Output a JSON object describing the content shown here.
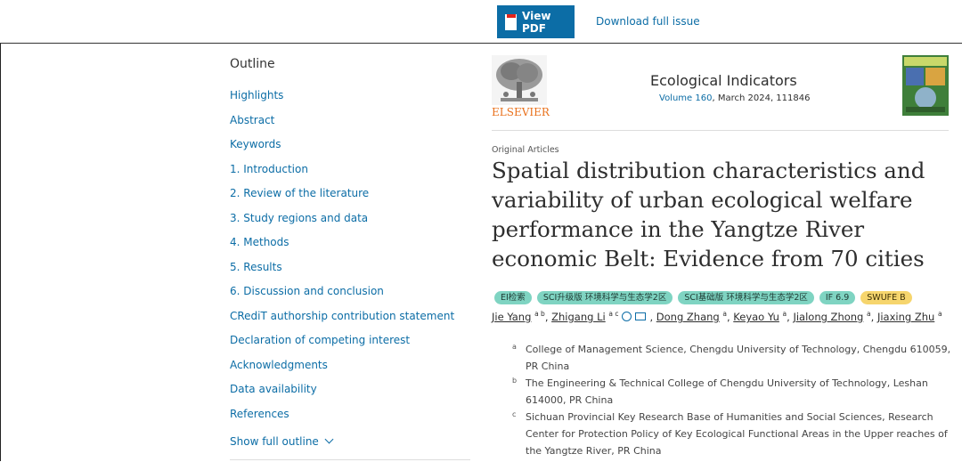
{
  "toolbar": {
    "view_pdf": "View PDF",
    "download_issue": "Download full issue"
  },
  "outline": {
    "title": "Outline",
    "items": [
      "Highlights",
      "Abstract",
      "Keywords",
      "1. Introduction",
      "2. Review of the literature",
      "3. Study regions and data",
      "4. Methods",
      "5. Results",
      "6. Discussion and conclusion",
      "CRediT authorship contribution statement",
      "Declaration of competing interest",
      "Acknowledgments",
      "Data availability",
      "References"
    ],
    "show_full": "Show full outline"
  },
  "header": {
    "publisher": "ELSEVIER",
    "journal": "Ecological Indicators",
    "volume_link": "Volume 160",
    "volume_rest": ", March 2024, 111846"
  },
  "article": {
    "type": "Original Articles",
    "title": "Spatial distribution characteristics and variability of urban ecological welfare performance in the Yangtze River economic Belt: Evidence from 70 cities",
    "badges": [
      "EI检索",
      "SCI升级版 环境科学与生态学2区",
      "SCI基础版 环境科学与生态学2区",
      "IF 6.9",
      "SWUFE B"
    ],
    "authors": [
      {
        "name": "Jie Yang",
        "sup": "a b"
      },
      {
        "name": "Zhigang Li",
        "sup": "a c"
      },
      {
        "name": "Dong Zhang",
        "sup": "a"
      },
      {
        "name": "Keyao Yu",
        "sup": "a"
      },
      {
        "name": "Jialong Zhong",
        "sup": "a"
      },
      {
        "name": "Jiaxing Zhu",
        "sup": "a"
      }
    ],
    "affiliations": [
      {
        "label": "a",
        "text": "College of Management Science, Chengdu University of Technology, Chengdu 610059, PR China"
      },
      {
        "label": "b",
        "text": "The Engineering & Technical College of Chengdu University of Technology, Leshan 614000, PR China"
      },
      {
        "label": "c",
        "text": "Sichuan Provincial Key Research Base of Humanities and Social Sciences, Research Center for Protection Policy of Key Ecological Functional Areas in the Upper reaches of the Yangtze River, PR China"
      }
    ]
  },
  "colors": {
    "link": "#0c6da6",
    "badge_teal": "#7fd4c2",
    "badge_gold": "#f6d56d",
    "publisher_orange": "#e9711c"
  }
}
